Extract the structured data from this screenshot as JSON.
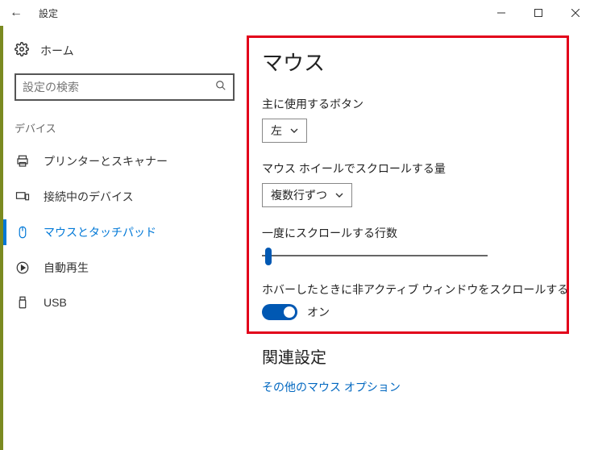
{
  "window": {
    "title": "設定"
  },
  "sidebar": {
    "home": "ホーム",
    "search_placeholder": "設定の検索",
    "category": "デバイス",
    "items": [
      {
        "label": "プリンターとスキャナー"
      },
      {
        "label": "接続中のデバイス"
      },
      {
        "label": "マウスとタッチパッド"
      },
      {
        "label": "自動再生"
      },
      {
        "label": "USB"
      }
    ]
  },
  "main": {
    "title": "マウス",
    "primary_button_label": "主に使用するボタン",
    "primary_button_value": "左",
    "wheel_label": "マウス ホイールでスクロールする量",
    "wheel_value": "複数行ずつ",
    "lines_label": "一度にスクロールする行数",
    "inactive_scroll_label": "ホバーしたときに非アクティブ ウィンドウをスクロールする",
    "toggle_state": "オン",
    "related_title": "関連設定",
    "related_link": "その他のマウス オプション"
  }
}
